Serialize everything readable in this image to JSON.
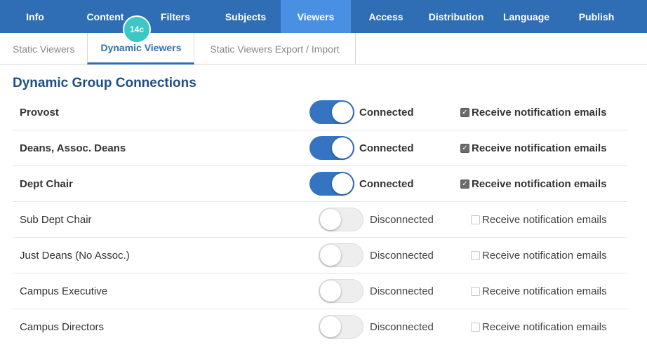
{
  "topnav": {
    "tabs": [
      {
        "label": "Info"
      },
      {
        "label": "Content"
      },
      {
        "label": "Filters"
      },
      {
        "label": "Subjects"
      },
      {
        "label": "Viewers",
        "active": true
      },
      {
        "label": "Access"
      },
      {
        "label": "Distribution"
      },
      {
        "label": "Language"
      },
      {
        "label": "Publish"
      }
    ],
    "badge": "14c",
    "active_color": "#4a90e2",
    "bar_color": "#2f6eb5"
  },
  "subtabs": [
    {
      "label": "Static Viewers"
    },
    {
      "label": "Dynamic Viewers",
      "active": true
    },
    {
      "label": "Static Viewers Export / Import"
    }
  ],
  "section": {
    "title": "Dynamic Group Connections"
  },
  "groups": [
    {
      "name": "Provost",
      "connected": true,
      "status": "Connected",
      "notify_label": "Receive notification emails",
      "notify_checked": true
    },
    {
      "name": "Deans, Assoc. Deans",
      "connected": true,
      "status": "Connected",
      "notify_label": "Receive notification emails",
      "notify_checked": true
    },
    {
      "name": "Dept Chair",
      "connected": true,
      "status": "Connected",
      "notify_label": "Receive notification emails",
      "notify_checked": true
    },
    {
      "name": "Sub Dept Chair",
      "connected": false,
      "status": "Disconnected",
      "notify_label": "Receive notification emails",
      "notify_checked": false
    },
    {
      "name": "Just Deans (No Assoc.)",
      "connected": false,
      "status": "Disconnected",
      "notify_label": "Receive notification emails",
      "notify_checked": false
    },
    {
      "name": "Campus Executive",
      "connected": false,
      "status": "Disconnected",
      "notify_label": "Receive notification emails",
      "notify_checked": false
    },
    {
      "name": "Campus Directors",
      "connected": false,
      "status": "Disconnected",
      "notify_label": "Receive notification emails",
      "notify_checked": false
    }
  ]
}
